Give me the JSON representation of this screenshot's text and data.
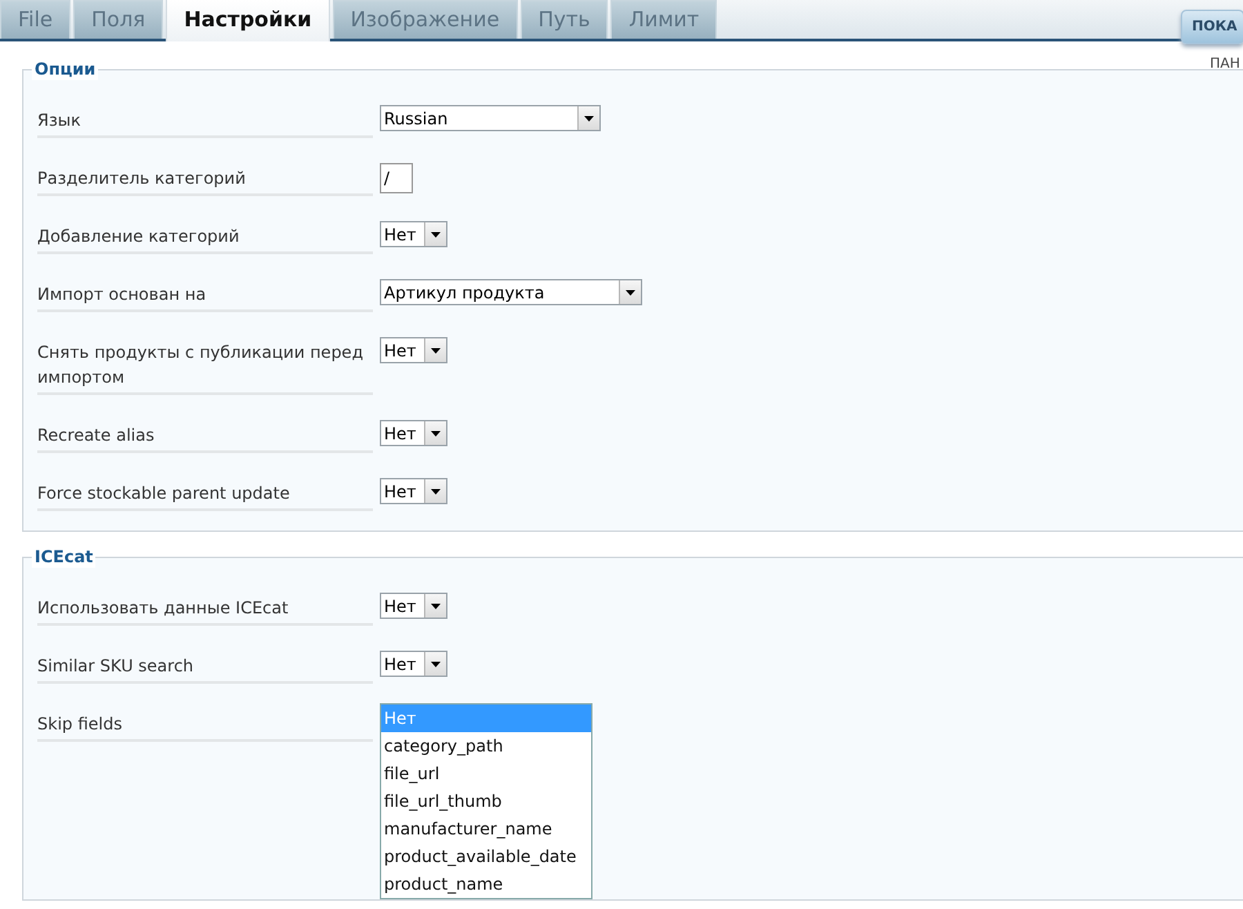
{
  "tabs": [
    {
      "label": "File",
      "selected": false
    },
    {
      "label": "Поля",
      "selected": false
    },
    {
      "label": "Настройки",
      "selected": true
    },
    {
      "label": "Изображение",
      "selected": false
    },
    {
      "label": "Путь",
      "selected": false
    },
    {
      "label": "Лимит",
      "selected": false
    }
  ],
  "top_button": {
    "label": "ПОКА"
  },
  "side_label": "ПАН",
  "sections": [
    {
      "legend": "Опции",
      "fields": [
        {
          "label": "Язык",
          "kind": "select",
          "value": "Russian"
        },
        {
          "label": "Разделитель категорий",
          "kind": "text",
          "value": "/"
        },
        {
          "label": "Добавление категорий",
          "kind": "select",
          "value": "Нет"
        },
        {
          "label": "Импорт основан на",
          "kind": "select",
          "value": "Артикул продукта"
        },
        {
          "label": "Снять продукты с публикации перед импортом",
          "kind": "select",
          "value": "Нет"
        },
        {
          "label": "Recreate alias",
          "kind": "select",
          "value": "Нет"
        },
        {
          "label": "Force stockable parent update",
          "kind": "select",
          "value": "Нет"
        }
      ]
    },
    {
      "legend": "ICEcat",
      "fields": [
        {
          "label": "Использовать данные ICEcat",
          "kind": "select",
          "value": "Нет"
        },
        {
          "label": "Similar SKU search",
          "kind": "select",
          "value": "Нет"
        },
        {
          "label": "Skip fields",
          "kind": "listbox",
          "options": [
            {
              "label": "Нет",
              "selected": true
            },
            {
              "label": "category_path",
              "selected": false
            },
            {
              "label": "file_url",
              "selected": false
            },
            {
              "label": "file_url_thumb",
              "selected": false
            },
            {
              "label": "manufacturer_name",
              "selected": false
            },
            {
              "label": "product_available_date",
              "selected": false
            },
            {
              "label": "product_name",
              "selected": false
            }
          ]
        }
      ]
    }
  ]
}
